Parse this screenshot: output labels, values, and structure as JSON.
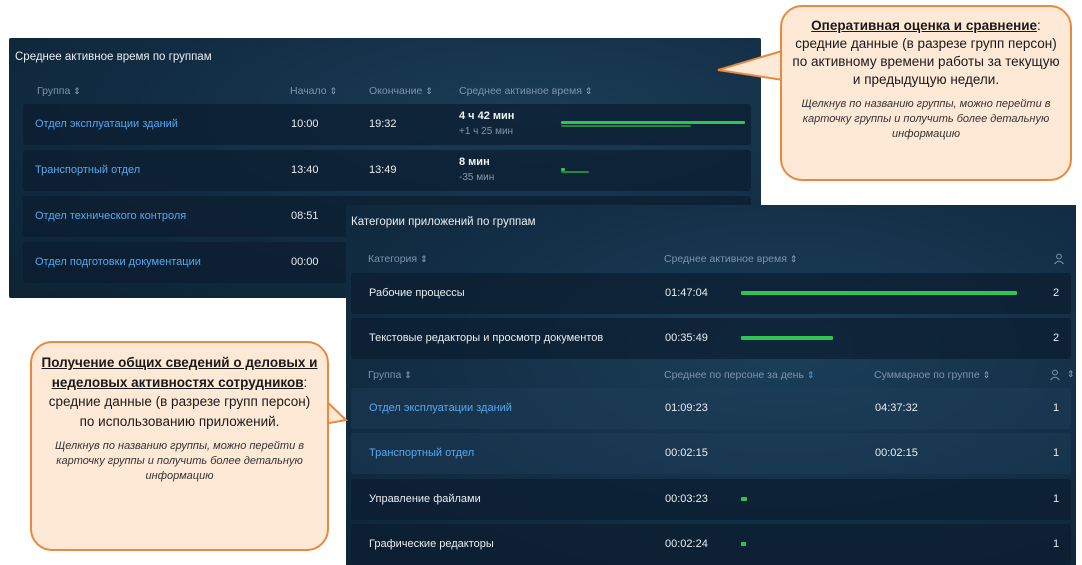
{
  "panel1": {
    "title": "Среднее активное время по группам",
    "headers": {
      "group": "Группа",
      "start": "Начало",
      "end": "Окончание",
      "avg": "Среднее активное время"
    },
    "rows": [
      {
        "group": "Отдел эксплуатации зданий",
        "start": "10:00",
        "end": "19:32",
        "avg": "4 ч 42 мин",
        "diff": "+1 ч 25 мин",
        "current_fraction": 0.4,
        "previous_fraction": 0.28
      },
      {
        "group": "Транспортный отдел",
        "start": "13:40",
        "end": "13:49",
        "avg": "8 мин",
        "diff": "-35 мин",
        "current_fraction": 0.01,
        "previous_fraction": 0.05
      },
      {
        "group": "Отдел технического контроля",
        "start": "08:51"
      },
      {
        "group": "Отдел подготовки документации",
        "start": "00:00"
      }
    ],
    "colors": {
      "link": "#58a8ec",
      "bar_current": "#2dc653",
      "bar_previous": "#1f8a3a"
    }
  },
  "panel2": {
    "title": "Категории приложений по группам",
    "headers": {
      "category": "Категория",
      "avg": "Среднее активное время",
      "person_icon": "person-icon"
    },
    "categories": [
      {
        "name": "Рабочие процессы",
        "time": "01:47:04",
        "count": "2",
        "bar_fraction": 1.0
      },
      {
        "name": "Текстовые редакторы и просмотр документов",
        "time": "00:35:49",
        "count": "2",
        "bar_fraction": 0.33
      }
    ],
    "sub_headers": {
      "group": "Группа",
      "avg_per_person": "Среднее по персоне за день",
      "total_group": "Суммарное по группе"
    },
    "sub_rows": [
      {
        "group": "Отдел эксплуатации зданий",
        "avg_per_person": "01:09:23",
        "total": "04:37:32",
        "count": "1"
      },
      {
        "group": "Транспортный отдел",
        "avg_per_person": "00:02:15",
        "total": "00:02:15",
        "count": "1"
      }
    ],
    "categories_more": [
      {
        "name": "Управление файлами",
        "time": "00:03:23",
        "count": "1",
        "bar_fraction": 0.03
      },
      {
        "name": "Графические редакторы",
        "time": "00:02:24",
        "count": "1",
        "bar_fraction": 0.02
      }
    ]
  },
  "callout_right": {
    "heading": "Оперативная оценка и сравнение",
    "text": ": средние данные (в разрезе групп персон) по активному времени работы за текущую и предыдущую недели.",
    "note": "Щелкнув по названию группы, можно перейти в карточку группы и получить более детальную информацию"
  },
  "callout_left": {
    "heading": "Получение общих сведений о деловых и неделовых активностях сотрудников",
    "text": ": средние данные (в разрезе групп персон) по использованию приложений.",
    "note": "Щелкнув по названию группы, можно перейти в карточку группы и получить более детальную информацию"
  }
}
